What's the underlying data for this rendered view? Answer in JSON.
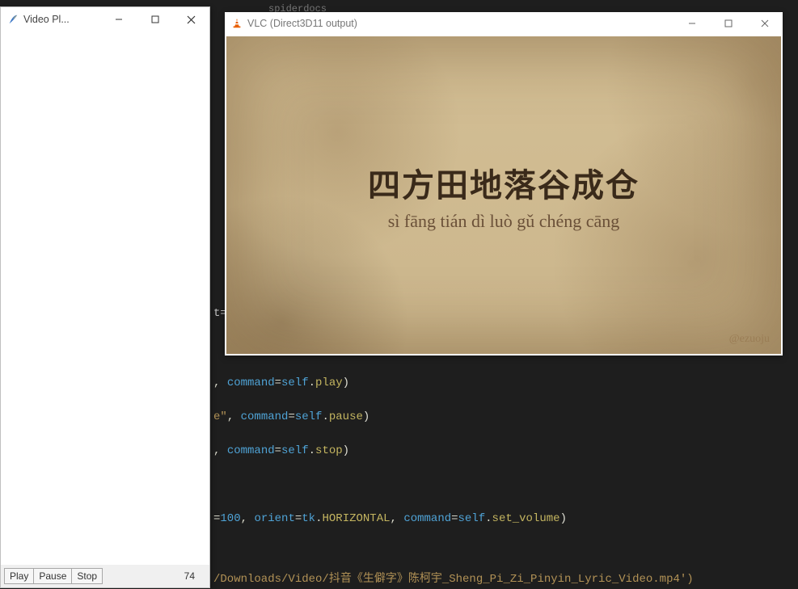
{
  "tk_window": {
    "title": "Video Pl...",
    "buttons": {
      "play": "Play",
      "pause": "Pause",
      "stop": "Stop"
    },
    "volume_value": "74"
  },
  "vlc_window": {
    "title": "VLC (Direct3D11 output)",
    "video": {
      "lyric_cn": "四方田地落谷成仓",
      "lyric_pinyin": "sì fāng tián dì luò gǔ chéng cāng",
      "watermark": "@ezuoju"
    }
  },
  "background_tab": "spiderdocs",
  "editor": {
    "line1": {
      "pre": ", ",
      "k": "command",
      "eq": "=",
      "v1": "self",
      "dot": ".",
      "v2": "play",
      "rp": ")"
    },
    "line2": {
      "s": "\"",
      "comma": ", ",
      "k": "command",
      "eq": "=",
      "v1": "self",
      "dot": ".",
      "v2": "pause",
      "rp": ")"
    },
    "line3": {
      "pre": ", ",
      "k": "command",
      "eq": "=",
      "v1": "self",
      "dot": ".",
      "v2": "stop",
      "rp": ")"
    },
    "line4": {
      "n": "=100",
      "comma": ", ",
      "k1": "orient",
      "eq1": "=",
      "v1": "tk",
      "dot1": ".",
      "c1": "HORIZONTAL",
      "comma2": ", ",
      "k2": "command",
      "eq2": "=",
      "v2": "self",
      "dot2": ".",
      "v3": "set_volume",
      "rp": ")"
    },
    "line5": {
      "t": "=",
      "path_open": "(",
      "dl": "Downloads",
      "sep1": "/",
      "vid": "Video",
      "rest": "抖音《生僻字》陈柯宇_Sheng_Pi_Zi_Pinyin_Lyric_Video.mp4')"
    }
  }
}
